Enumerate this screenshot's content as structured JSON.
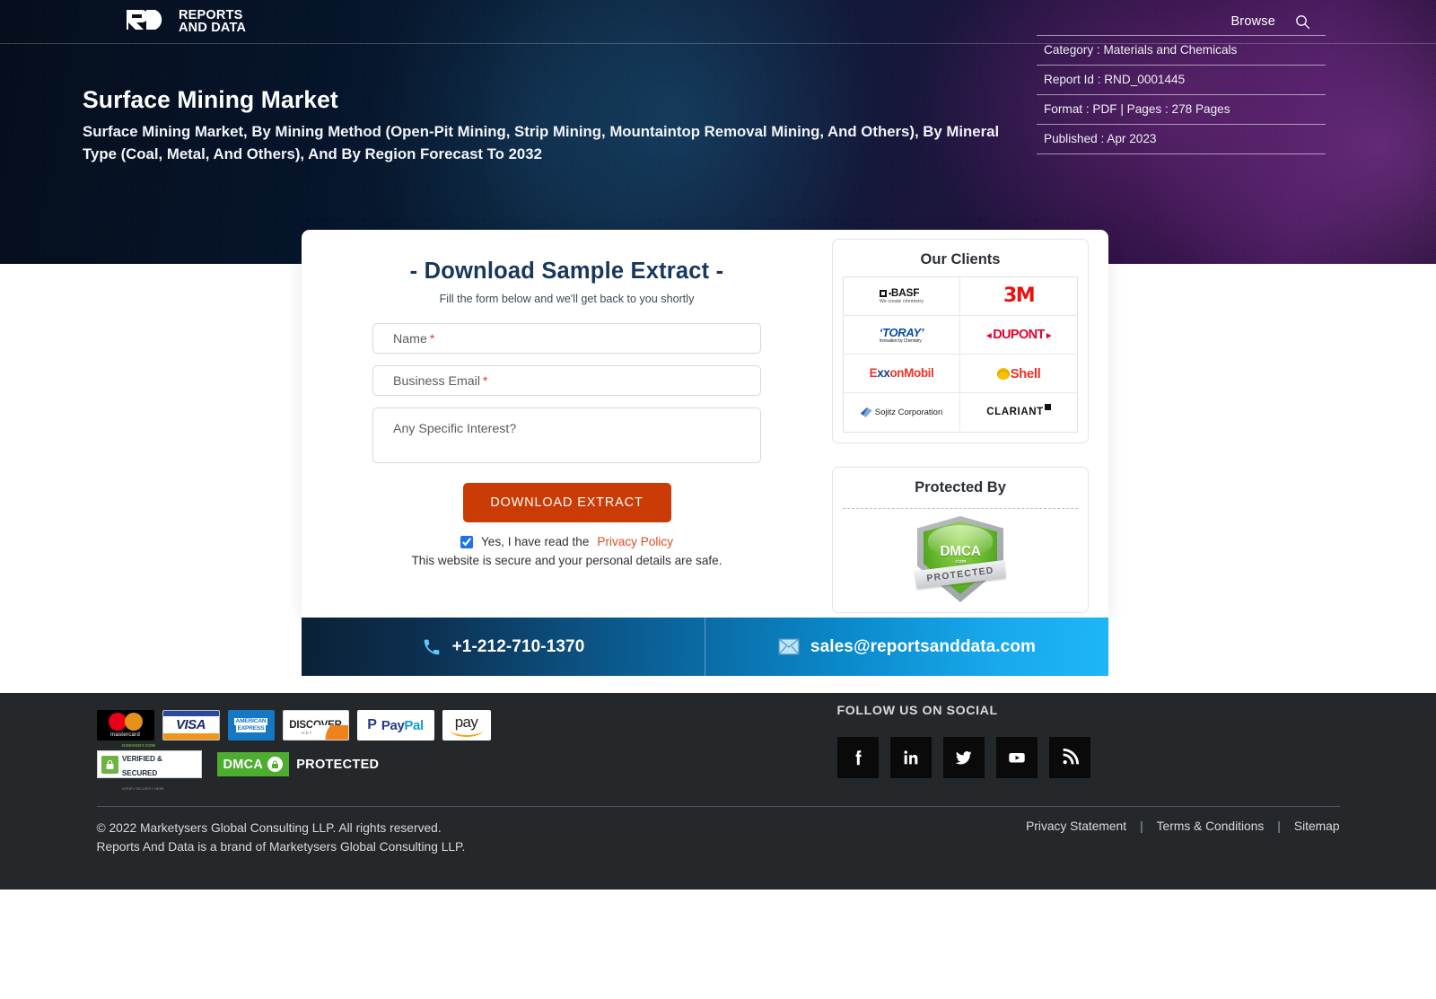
{
  "nav": {
    "logo_top": "REPORTS",
    "logo_bottom": "AND DATA",
    "logo_mark": "RD",
    "browse_label": "Browse",
    "search_icon": "search-icon"
  },
  "hero": {
    "title": "Surface Mining Market",
    "subtitle": "Surface Mining Market, By Mining Method (Open-Pit Mining, Strip Mining, Mountaintop Removal Mining, And Others), By Mineral Type (Coal, Metal, And Others), And By Region Forecast To 2032",
    "meta": [
      {
        "label": "Category",
        "value": "Materials and Chemicals",
        "text": "Category : Materials and Chemicals"
      },
      {
        "label": "Report Id",
        "value": "RND_0001445",
        "text": "Report Id : RND_0001445"
      },
      {
        "label": "Format",
        "value": "PDF",
        "text": "Format : PDF  |  Pages : 278 Pages"
      },
      {
        "label": "Published",
        "value": "Apr 2023",
        "text": "Published : Apr 2023"
      }
    ]
  },
  "form": {
    "title": "- Download Sample Extract -",
    "subtitle": "Fill the form below and we'll get back to you shortly",
    "fields": [
      {
        "name": "name",
        "placeholder": "Name",
        "value": "",
        "required": true,
        "required_mark": "*"
      },
      {
        "name": "business_email",
        "placeholder": "Business Email",
        "value": "",
        "required": true,
        "required_mark": "*"
      },
      {
        "name": "specific_interest",
        "placeholder": "Any Specific Interest?",
        "value": "",
        "required": false,
        "required_mark": ""
      }
    ],
    "submit_label": "DOWNLOAD EXTRACT",
    "consent_text": "Yes, I have read the",
    "privacy_link": "Privacy Policy",
    "consent_checked": true,
    "secure_note": "This website is secure and your personal details are safe."
  },
  "clients": {
    "title": "Our Clients",
    "logos": [
      {
        "name": "BASF",
        "tagline": "We create chemistry"
      },
      {
        "name": "3M",
        "tagline": ""
      },
      {
        "name": "TORAY",
        "tagline": "Innovation by Chemistry"
      },
      {
        "name": "DUPONT",
        "tagline": ""
      },
      {
        "name": "ExxonMobil",
        "tagline": ""
      },
      {
        "name": "Shell",
        "tagline": ""
      },
      {
        "name": "Sojitz Corporation",
        "tagline": ""
      },
      {
        "name": "CLARIANT",
        "tagline": ""
      }
    ]
  },
  "protected": {
    "title": "Protected By",
    "badge_name": "DMCA",
    "badge_com": ".com",
    "badge_ribbon": "PROTECTED"
  },
  "contact": {
    "phone": "+1-212-710-1370",
    "email": "sales@reportsanddata.com",
    "phone_icon": "phone-icon",
    "email_icon": "mail-icon"
  },
  "footer": {
    "payments": [
      {
        "name": "mastercard",
        "label": "mastercard"
      },
      {
        "name": "visa",
        "label": "VISA"
      },
      {
        "name": "american-express",
        "label_top": "AMERICAN",
        "label_bottom": "EXPRESS"
      },
      {
        "name": "discover",
        "label": "DISCOVER",
        "sub": "NETWORK"
      },
      {
        "name": "paypal",
        "label_a": "Pay",
        "label_b": "Pal"
      },
      {
        "name": "amazon-pay",
        "label": "pay"
      }
    ],
    "godaddy": {
      "top": "GODADDY.COM",
      "mid": "VERIFIED & SECURED",
      "bottom": "VERIFY SECURITY HERE"
    },
    "dmca": {
      "brand": "DMCA",
      "suffix": "PROTECTED"
    },
    "social_title": "FOLLOW US ON SOCIAL",
    "social": [
      {
        "name": "facebook",
        "glyph": "f"
      },
      {
        "name": "linkedin",
        "glyph": "in"
      },
      {
        "name": "twitter",
        "glyph": "twitter"
      },
      {
        "name": "youtube",
        "glyph": "youtube"
      },
      {
        "name": "rss",
        "glyph": "rss"
      }
    ],
    "copyright_line1": "© 2022 Marketysers Global Consulting LLP. All rights reserved.",
    "copyright_line2": "Reports And Data is a brand of Marketysers Global Consulting LLP.",
    "links": [
      {
        "label": "Privacy Statement"
      },
      {
        "label": "Terms & Conditions"
      },
      {
        "label": "Sitemap"
      }
    ],
    "link_separator": "|"
  },
  "colors": {
    "accent_orange": "#cb3b06",
    "privacy_link": "#dd4b1d",
    "form_title": "#17375e",
    "footer_bg": "#24282b",
    "contact_gradient_start": "#0a2136",
    "contact_gradient_end": "#1eb6f7"
  }
}
